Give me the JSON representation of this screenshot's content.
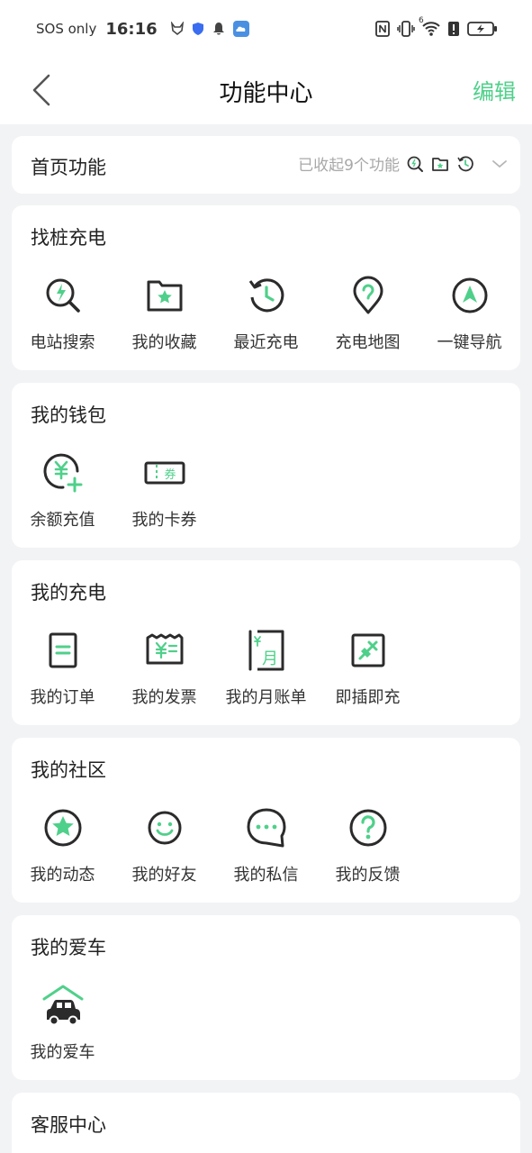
{
  "status_bar": {
    "carrier": "SOS only",
    "time": "16:16",
    "wifi_badge": "6"
  },
  "nav": {
    "title": "功能中心",
    "edit_label": "编辑"
  },
  "home_section": {
    "title": "首页功能",
    "collapsed_text": "已收起9个功能"
  },
  "sections": [
    {
      "title": "找桩充电",
      "items": [
        {
          "label": "电站搜索",
          "icon": "station-search-icon"
        },
        {
          "label": "我的收藏",
          "icon": "favorites-folder-icon"
        },
        {
          "label": "最近充电",
          "icon": "recent-history-icon"
        },
        {
          "label": "充电地图",
          "icon": "map-pin-icon"
        },
        {
          "label": "一键导航",
          "icon": "navigation-icon"
        }
      ]
    },
    {
      "title": "我的钱包",
      "items": [
        {
          "label": "余额充值",
          "icon": "balance-recharge-icon"
        },
        {
          "label": "我的卡券",
          "icon": "coupon-icon",
          "glyph": "券"
        }
      ]
    },
    {
      "title": "我的充电",
      "items": [
        {
          "label": "我的订单",
          "icon": "order-icon"
        },
        {
          "label": "我的发票",
          "icon": "invoice-icon"
        },
        {
          "label": "我的月账单",
          "icon": "monthly-bill-icon",
          "glyph": "月"
        },
        {
          "label": "即插即充",
          "icon": "plug-and-charge-icon"
        }
      ]
    },
    {
      "title": "我的社区",
      "items": [
        {
          "label": "我的动态",
          "icon": "star-circle-icon"
        },
        {
          "label": "我的好友",
          "icon": "smiley-icon"
        },
        {
          "label": "我的私信",
          "icon": "chat-bubble-icon"
        },
        {
          "label": "我的反馈",
          "icon": "question-icon"
        }
      ]
    },
    {
      "title": "我的爱车",
      "items": [
        {
          "label": "我的爱车",
          "icon": "car-garage-icon"
        }
      ]
    },
    {
      "title": "客服中心",
      "items": []
    }
  ],
  "colors": {
    "accent": "#4fd08a",
    "icon_dark": "#2b2b2b",
    "background": "#f2f3f5"
  }
}
